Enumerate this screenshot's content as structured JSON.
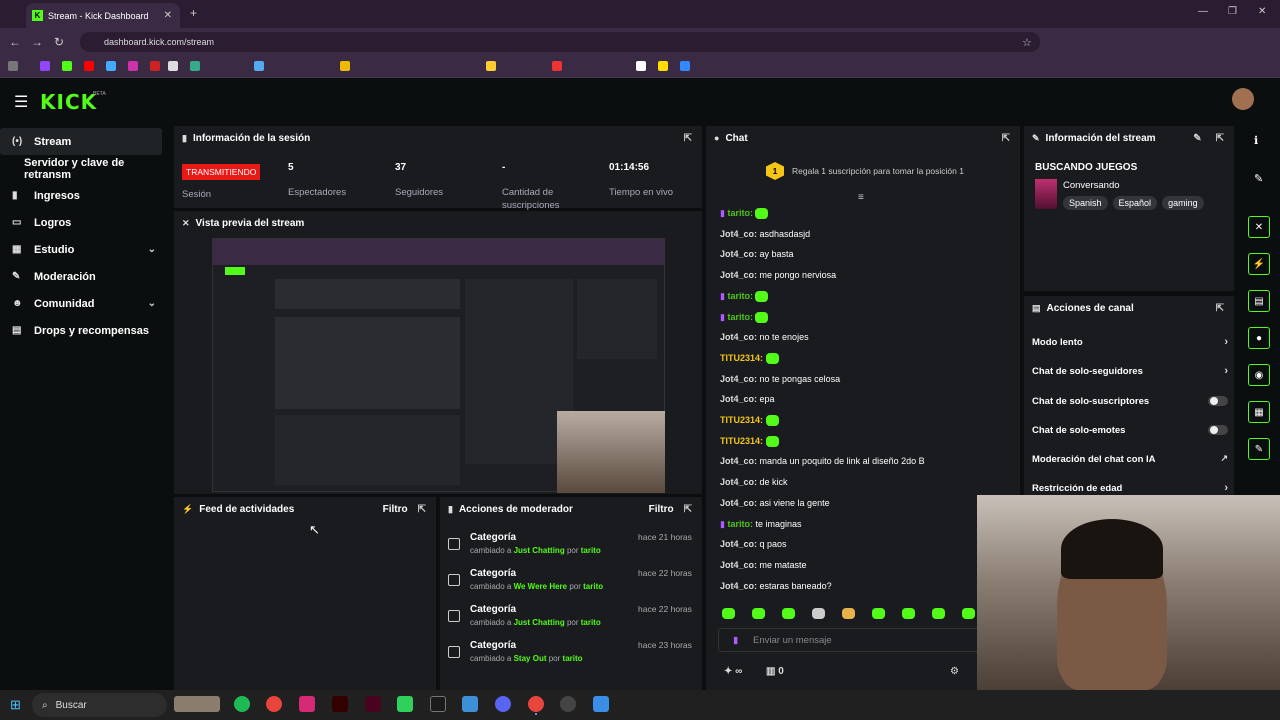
{
  "browser": {
    "tab_title": "Stream - Kick Dashboard",
    "url": "dashboard.kick.com/stream"
  },
  "brand": {
    "logo": "KICK",
    "beta": "BETA",
    "accent": "#53fc18"
  },
  "sidebar": {
    "items": [
      {
        "label": "Stream",
        "icon": "broadcast-icon",
        "active": true
      },
      {
        "label": "Servidor y clave de retransm",
        "icon": "",
        "sub": true
      },
      {
        "label": "Ingresos",
        "icon": "chart-icon"
      },
      {
        "label": "Logros",
        "icon": "trophy-icon"
      },
      {
        "label": "Estudio",
        "icon": "studio-icon",
        "expand": true
      },
      {
        "label": "Moderación",
        "icon": "wrench-icon"
      },
      {
        "label": "Comunidad",
        "icon": "people-icon",
        "expand": true
      },
      {
        "label": "Drops y recompensas",
        "icon": "gift-icon"
      }
    ]
  },
  "session": {
    "title": "Información de la sesión",
    "status": "TRANSMITIENDO",
    "status_label": "Sesión",
    "stats": [
      {
        "value": "5",
        "label": "Espectadores"
      },
      {
        "value": "37",
        "label": "Seguidores"
      },
      {
        "value": "-",
        "label": "Cantidad de suscripciones"
      },
      {
        "value": "01:14:56",
        "label": "Tiempo en vivo"
      }
    ]
  },
  "preview": {
    "title": "Vista previa del stream"
  },
  "feed": {
    "title": "Feed de actividades",
    "filter": "Filtro"
  },
  "modactions": {
    "title": "Acciones de moderador",
    "filter": "Filtro",
    "items": [
      {
        "title": "Categoría",
        "text": "cambiado a",
        "value": "Just Chatting",
        "by": "por",
        "user": "tarito",
        "time": "hace 21 horas"
      },
      {
        "title": "Categoría",
        "text": "cambiado a",
        "value": "We Were Here",
        "by": "por",
        "user": "tarito",
        "time": "hace 22 horas"
      },
      {
        "title": "Categoría",
        "text": "cambiado a",
        "value": "Just Chatting",
        "by": "por",
        "user": "tarito",
        "time": "hace 22 horas"
      },
      {
        "title": "Categoría",
        "text": "cambiado a",
        "value": "Stay Out",
        "by": "por",
        "user": "tarito",
        "time": "hace 23 horas"
      }
    ]
  },
  "chat": {
    "title": "Chat",
    "gift_badge": "1",
    "gift_text": "Regala 1 suscripción para tomar la posición 1",
    "placeholder": "Enviar un mensaje",
    "count_a": "∞",
    "count_b": "0",
    "messages": [
      {
        "user": "tarito:",
        "text": "",
        "emote": true,
        "color": "g"
      },
      {
        "user": "Jot4_co:",
        "text": "asdhasdasjd"
      },
      {
        "user": "Jot4_co:",
        "text": "ay basta"
      },
      {
        "user": "Jot4_co:",
        "text": "me pongo nerviosa"
      },
      {
        "user": "tarito:",
        "text": "",
        "emote": true,
        "color": "g"
      },
      {
        "user": "tarito:",
        "text": "",
        "emote": true,
        "color": "g"
      },
      {
        "user": "Jot4_co:",
        "text": "no te enojes"
      },
      {
        "user": "TITU2314:",
        "text": "",
        "emote": true,
        "color": "y"
      },
      {
        "user": "Jot4_co:",
        "text": "no te pongas celosa"
      },
      {
        "user": "Jot4_co:",
        "text": "epa"
      },
      {
        "user": "TITU2314:",
        "text": "",
        "emote": true,
        "color": "y"
      },
      {
        "user": "TITU2314:",
        "text": "",
        "emote": true,
        "color": "y"
      },
      {
        "user": "Jot4_co:",
        "text": "manda un poquito de link al diseño 2do B"
      },
      {
        "user": "Jot4_co:",
        "text": "de kick"
      },
      {
        "user": "Jot4_co:",
        "text": "asi viene la gente"
      },
      {
        "user": "tarito:",
        "text": "te imaginas",
        "color": "g"
      },
      {
        "user": "Jot4_co:",
        "text": "q paos"
      },
      {
        "user": "Jot4_co:",
        "text": "me mataste"
      },
      {
        "user": "Jot4_co:",
        "text": "estaras baneado?"
      }
    ]
  },
  "streaminfo": {
    "title": "Información del stream",
    "stream_title": "BUSCANDO JUEGOS",
    "category": "Conversando",
    "tags": [
      "Spanish",
      "Español",
      "gaming"
    ]
  },
  "channel": {
    "title": "Acciones de canal",
    "items": [
      {
        "label": "Modo lento",
        "control": "arrow"
      },
      {
        "label": "Chat de solo-seguidores",
        "control": "arrow"
      },
      {
        "label": "Chat de solo-suscriptores",
        "control": "toggle"
      },
      {
        "label": "Chat de solo-emotes",
        "control": "toggle"
      },
      {
        "label": "Moderación del chat con IA",
        "control": "external"
      },
      {
        "label": "Restricción de edad",
        "control": "arrow"
      }
    ]
  },
  "taskbar": {
    "search": "Buscar"
  }
}
